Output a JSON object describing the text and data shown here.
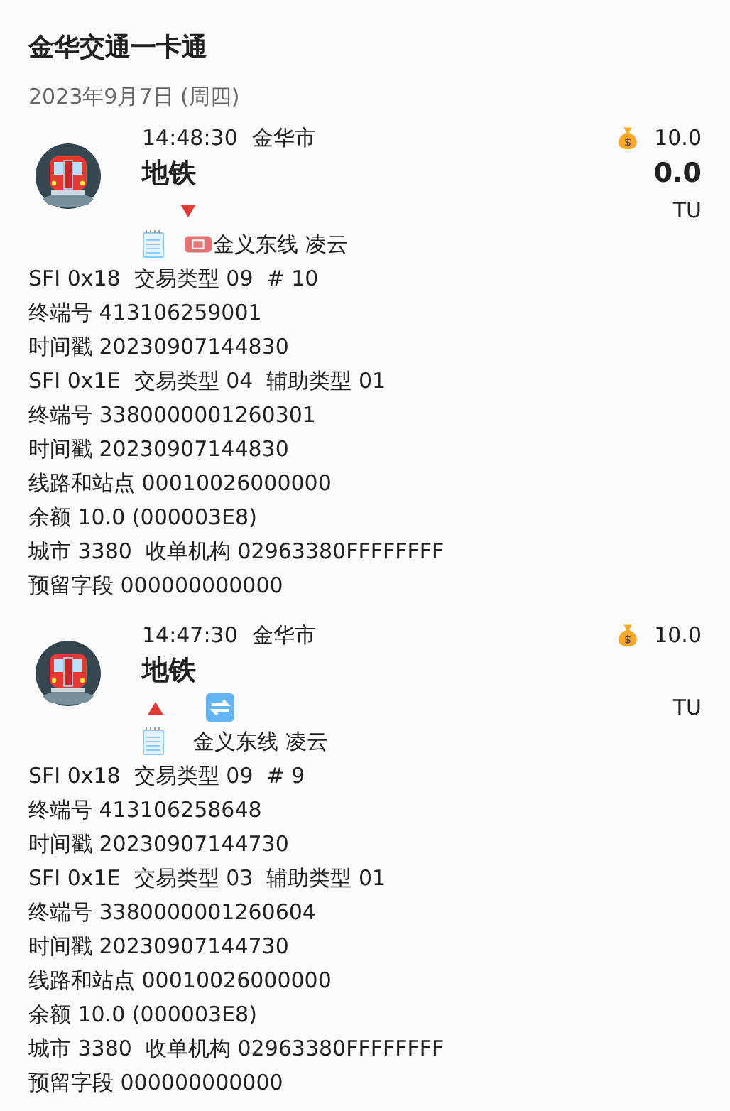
{
  "app_title": "金华交通一卡通",
  "date": "2023年9月7日 (周四)",
  "records": [
    {
      "time": "14:48:30",
      "city": "金华市",
      "title": "地铁",
      "balance": "10.0",
      "amount": "0.0",
      "unit": "TU",
      "down": true,
      "transfer": false,
      "ticket": true,
      "line": "金义东线 凌云",
      "details": [
        "SFI 0x18  交易类型 09  # 10",
        "终端号 413106259001",
        "时间戳 20230907144830",
        "SFI 0x1E  交易类型 04  辅助类型 01",
        "终端号 3380000001260301",
        "时间戳 20230907144830",
        "线路和站点 00010026000000",
        "余额 10.0 (000003E8)",
        "城市 3380  收单机构 02963380FFFFFFFF",
        "预留字段 000000000000"
      ]
    },
    {
      "time": "14:47:30",
      "city": "金华市",
      "title": "地铁",
      "balance": "10.0",
      "unit": "TU",
      "down": false,
      "transfer": true,
      "ticket": false,
      "line": "金义东线 凌云",
      "details": [
        "SFI 0x18  交易类型 09  # 9",
        "终端号 413106258648",
        "时间戳 20230907144730",
        "SFI 0x1E  交易类型 03  辅助类型 01",
        "终端号 3380000001260604",
        "时间戳 20230907144730",
        "线路和站点 00010026000000",
        "余额 10.0 (000003E8)",
        "城市 3380  收单机构 02963380FFFFFFFF",
        "预留字段 000000000000"
      ]
    }
  ]
}
